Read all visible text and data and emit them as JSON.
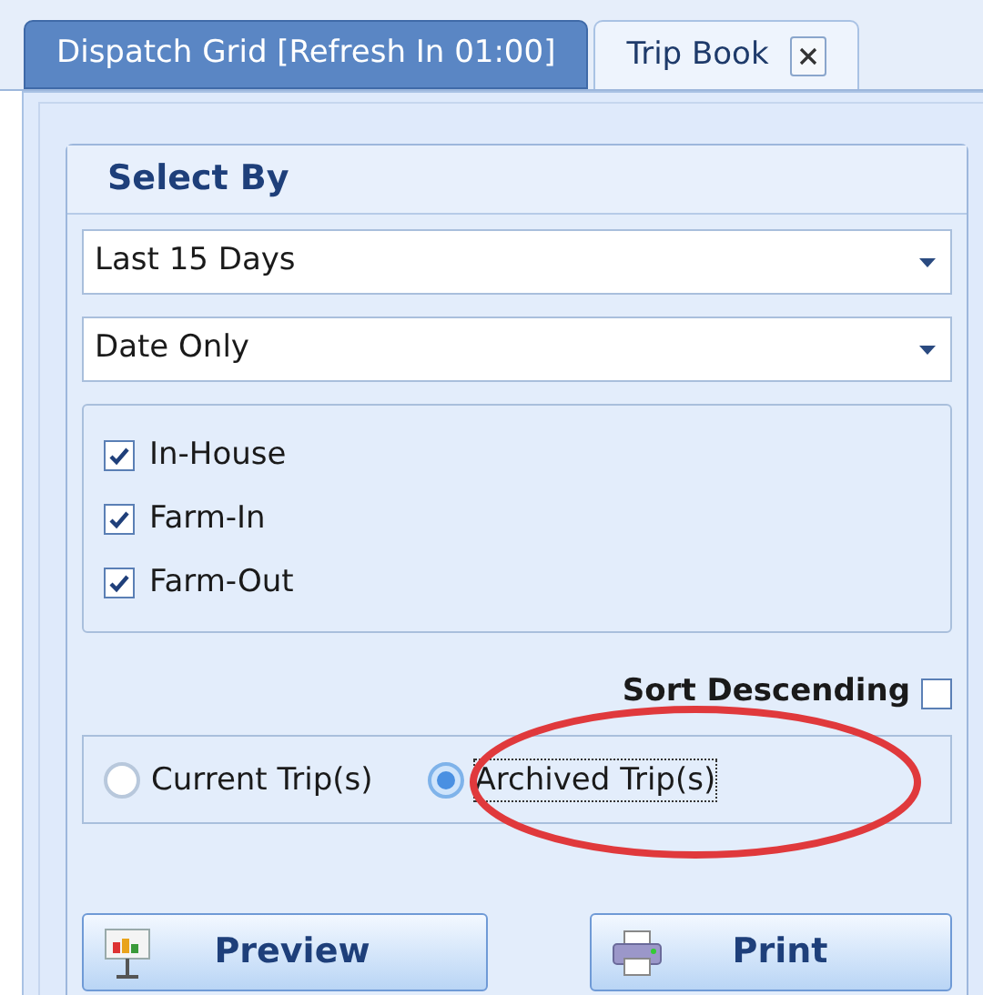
{
  "tabs": [
    {
      "label": "Dispatch Grid [Refresh In 01:00]",
      "selected": false
    },
    {
      "label": "Trip Book",
      "selected": true
    }
  ],
  "group_title": "Select By",
  "dropdowns": [
    {
      "value": "Last 15 Days"
    },
    {
      "value": "Date Only"
    }
  ],
  "checkboxes": [
    {
      "label": "In-House",
      "checked": true
    },
    {
      "label": "Farm-In",
      "checked": true
    },
    {
      "label": "Farm-Out",
      "checked": true
    }
  ],
  "sort_descending": {
    "label": "Sort Descending",
    "checked": false
  },
  "radios": [
    {
      "label": "Current Trip(s)",
      "selected": false
    },
    {
      "label": "Archived Trip(s)",
      "selected": true
    }
  ],
  "buttons": [
    {
      "kind": "preview",
      "label": "Preview"
    },
    {
      "kind": "print",
      "label": "Print"
    }
  ]
}
